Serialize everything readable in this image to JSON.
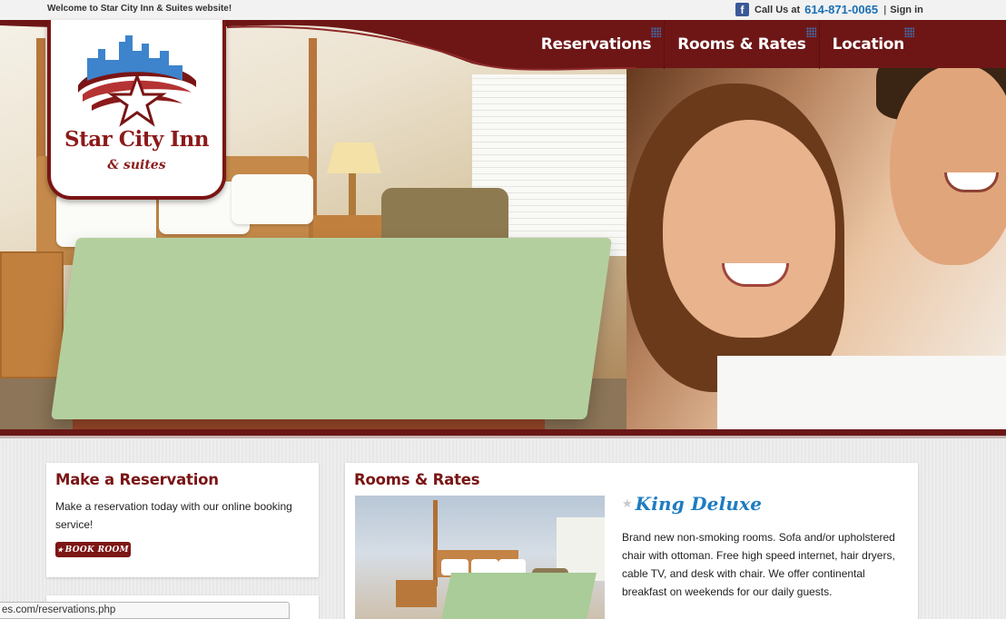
{
  "topbar": {
    "welcome": "Welcome to Star City Inn & Suites website!",
    "call_label": "Call Us at",
    "phone": "614-871-0065",
    "separator": "|",
    "signin": "Sign in"
  },
  "logo": {
    "title": "Star City Inn",
    "subtitle": "& suites"
  },
  "nav": {
    "items": [
      {
        "label": "Reservations"
      },
      {
        "label": "Rooms & Rates"
      },
      {
        "label": "Location"
      }
    ]
  },
  "reservation": {
    "heading": "Make a Reservation",
    "text": "Make a reservation today with our online booking service!",
    "button": "BOOK ROOM",
    "button_icon": "star-icon"
  },
  "rooms": {
    "heading": "Rooms & Rates",
    "room_name": "King Deluxe",
    "description": "Brand new non-smoking rooms. Sofa and/or upholstered chair with ottoman. Free high speed internet, hair dryers, cable TV, and desk with chair. We offer continental breakfast on weekends for our daily guests."
  },
  "statusbar": {
    "url": "es.com/reservations.php"
  },
  "colors": {
    "brand_maroon": "#7a1515",
    "link_blue": "#1e7cc0",
    "facebook": "#3b5998"
  }
}
